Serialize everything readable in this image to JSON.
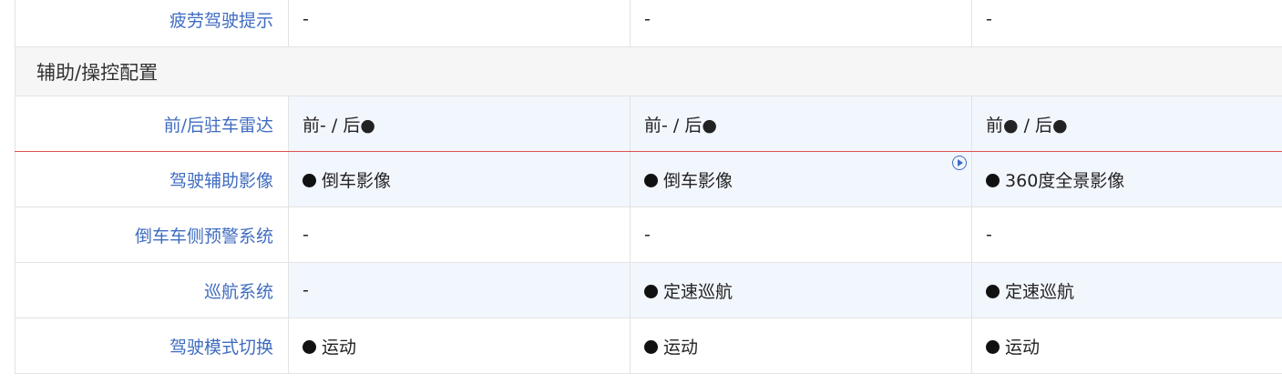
{
  "section_title": "辅助/操控配置",
  "dot_symbol": "●",
  "rows": [
    {
      "label": "疲劳驾驶提示",
      "values": [
        "-",
        "-",
        "-"
      ]
    },
    {
      "label": "前/后驻车雷达",
      "values": [
        "前- / 后●",
        "前- / 后●",
        "前● / 后●"
      ]
    },
    {
      "label": "驾驶辅助影像",
      "values": [
        "倒车影像",
        "倒车影像",
        "360度全景影像"
      ],
      "dots": [
        true,
        true,
        true
      ]
    },
    {
      "label": "倒车车侧预警系统",
      "values": [
        "-",
        "-",
        "-"
      ]
    },
    {
      "label": "巡航系统",
      "values": [
        "-",
        "定速巡航",
        "定速巡航"
      ],
      "dots": [
        false,
        true,
        true
      ]
    },
    {
      "label": "驾驶模式切换",
      "values": [
        "运动",
        "运动",
        "运动"
      ],
      "dots": [
        true,
        true,
        true
      ]
    }
  ]
}
